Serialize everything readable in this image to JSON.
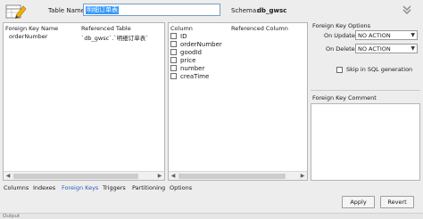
{
  "header": {
    "table_name_label": "Table Name:",
    "table_name_value": "明细订单表",
    "schema_label": "Schema:",
    "schema_value": "db_gwsc"
  },
  "foreign_keys": {
    "columns": [
      "Foreign Key Name",
      "Referenced Table"
    ],
    "rows": [
      {
        "name": "orderNumber",
        "table": "`db_gwsc`.`明细订单表`"
      }
    ]
  },
  "fk_columns": {
    "headers": [
      "Column",
      "Referenced Column"
    ],
    "items": [
      "ID",
      "orderNumber",
      "goodId",
      "price",
      "number",
      "creaTime"
    ]
  },
  "options": {
    "title": "Foreign Key Options",
    "on_update_label": "On Update:",
    "on_update_value": "NO ACTION",
    "on_delete_label": "On Delete:",
    "on_delete_value": "NO ACTION",
    "skip_label": "Skip in SQL generation",
    "comment_title": "Foreign Key Comment"
  },
  "tabs": [
    "Columns",
    "Indexes",
    "Foreign Keys",
    "Triggers",
    "Partitioning",
    "Options"
  ],
  "active_tab": "Foreign Keys",
  "buttons": {
    "apply": "Apply",
    "revert": "Revert"
  },
  "output_label": "Output",
  "colors": {
    "accent": "#2b5fb4",
    "selection": "#3399ff"
  }
}
